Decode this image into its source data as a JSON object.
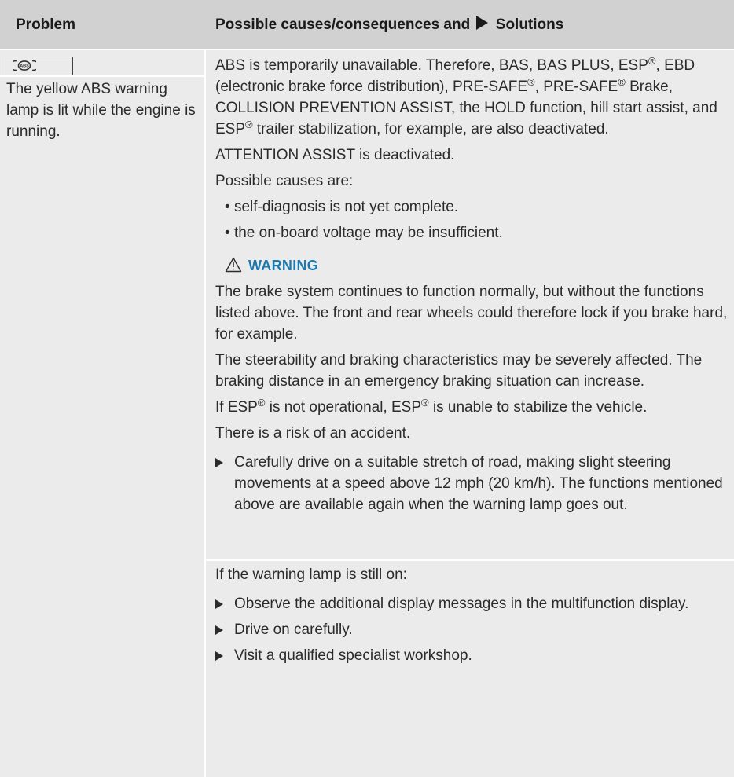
{
  "header": {
    "problem": "Problem",
    "solutions_prefix": "Possible causes/consequences and",
    "solutions_suffix": "Solutions"
  },
  "problem": {
    "lamp_icon_text": "ABS",
    "text": "The yellow ABS warning lamp is lit while the engine is running."
  },
  "solution": {
    "intro_parts": [
      "ABS is temporarily unavailable. Therefore, BAS, BAS PLUS, ESP",
      "®",
      ", EBD (electronic brake force distribution), PRE-SAFE",
      "®",
      ", PRE-SAFE",
      "®",
      " Brake, COLLISION PREVENTION ASSIST, the HOLD function, hill start assist, and ESP",
      "®",
      " trailer stabilization, for example, are also deactivated."
    ],
    "attention": "ATTENTION ASSIST is deactivated.",
    "causes_label": "Possible causes are:",
    "causes": [
      "self-diagnosis is not yet complete.",
      "the on-board voltage may be insufficient."
    ],
    "warning": {
      "title": "WARNING",
      "p1": "The brake system continues to function normally, but without the functions listed above. The front and rear wheels could therefore lock if you brake hard, for example.",
      "p2": "The steerability and braking characteristics may be severely affected. The braking distance in an emergency braking situation can increase.",
      "p3_parts": [
        "If ESP",
        "®",
        " is not operational, ESP",
        "®",
        " is unable to stabilize the vehicle."
      ],
      "p4": "There is a risk of an accident."
    },
    "step1": "Carefully drive on a suitable stretch of road, making slight steering movements at a speed above 12 mph (20 km/h). The functions mentioned above are available again when the warning lamp goes out.",
    "still_on": "If the warning lamp is still on:",
    "steps": [
      "Observe the additional display messages in the multifunction display.",
      "Drive on carefully.",
      "Visit a qualified specialist workshop."
    ]
  },
  "colors": {
    "header_bg": "#d1d1d1",
    "cell_bg": "#ebebeb",
    "warning_blue": "#1c79b0"
  },
  "icons": {
    "lamp": "abs-warning-lamp-icon",
    "warning": "warning-triangle-icon",
    "solutions_arrow": "triangle-right-icon",
    "step_arrow": "step-arrow-icon"
  }
}
